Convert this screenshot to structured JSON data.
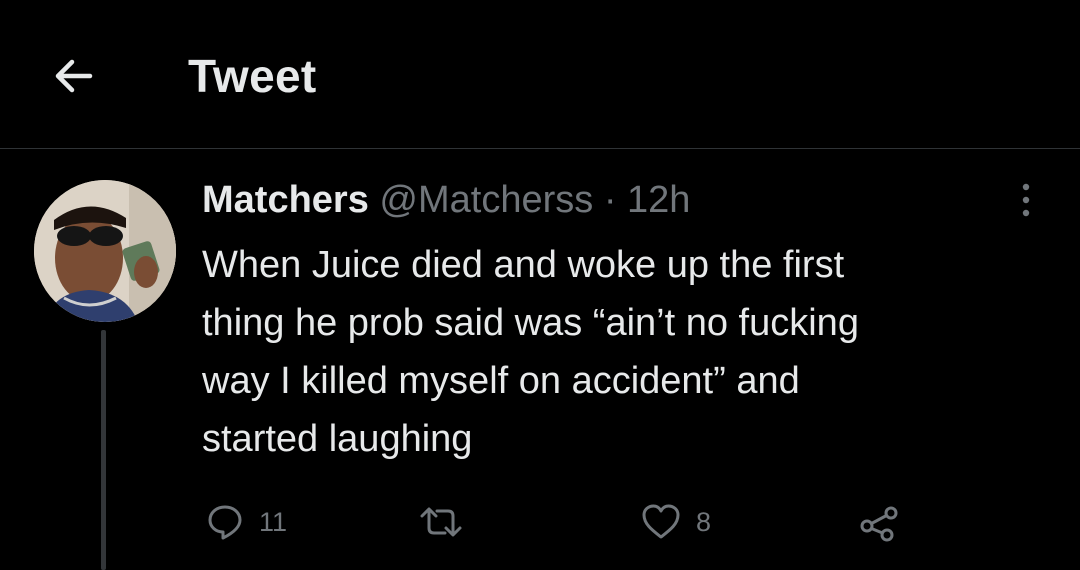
{
  "header": {
    "title": "Tweet",
    "back_icon": "arrow-left-icon"
  },
  "tweet": {
    "author_name": "Matchers",
    "handle": "@Matcherss",
    "separator": "·",
    "time": "12h",
    "text": "When Juice died and woke up the first\nthing he prob said was “ain’t no fucking\nway I killed myself on accident” and\nstarted laughing",
    "more_icon": "more-vertical-icon"
  },
  "actions": {
    "reply": {
      "icon": "reply-icon",
      "count": "11"
    },
    "retweet": {
      "icon": "retweet-icon",
      "count": ""
    },
    "like": {
      "icon": "heart-icon",
      "count": "8"
    },
    "share": {
      "icon": "share-icon"
    }
  },
  "colors": {
    "background": "#000000",
    "text_primary": "#e7e9ea",
    "text_secondary": "#71767b",
    "divider": "#2f3336"
  }
}
